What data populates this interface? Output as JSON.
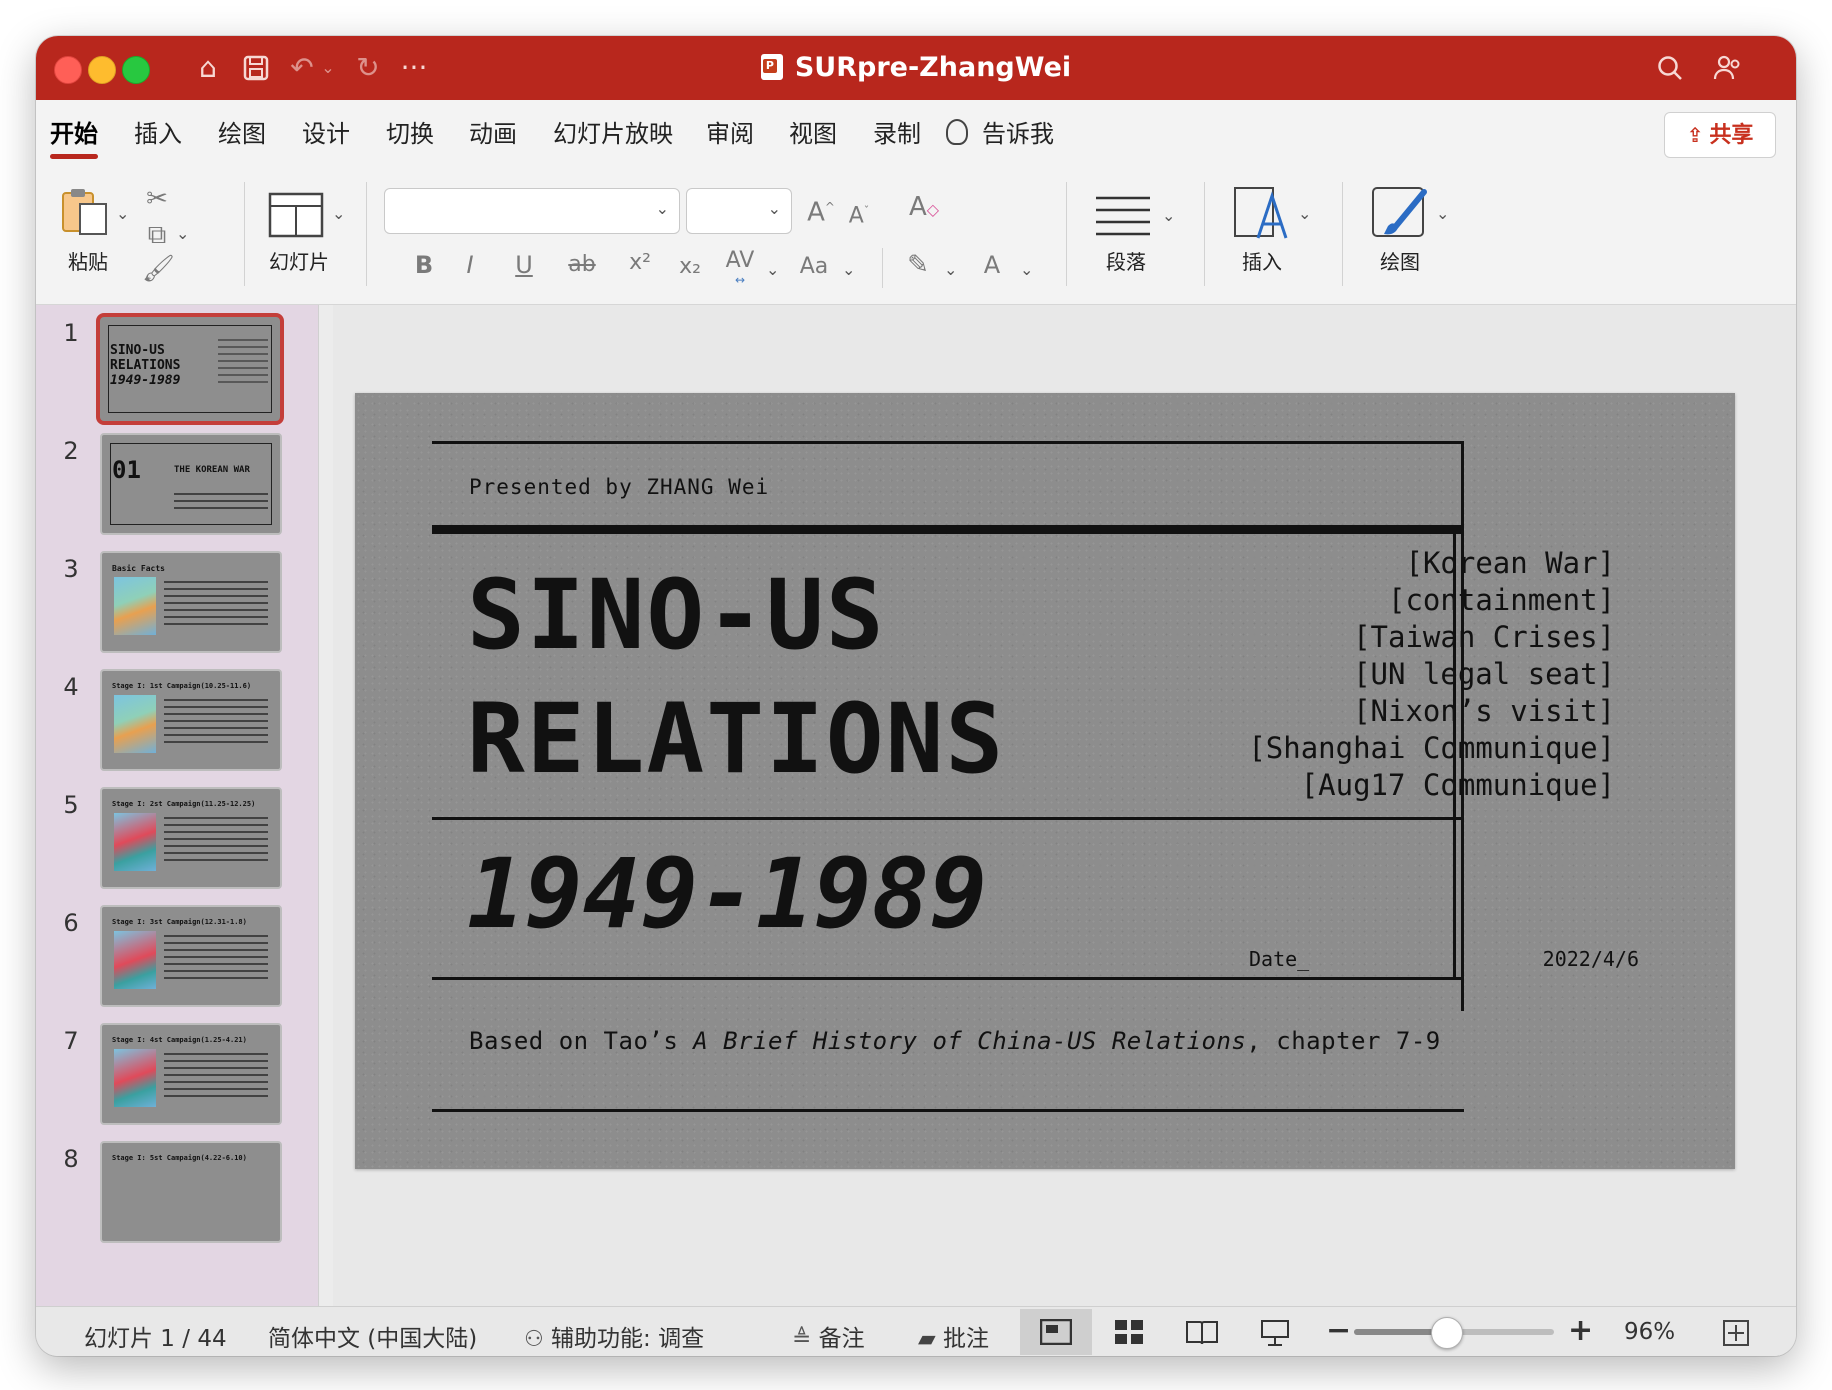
{
  "window": {
    "title": "SURpre-ZhangWei"
  },
  "tabs": [
    {
      "label": "开始",
      "active": true
    },
    {
      "label": "插入"
    },
    {
      "label": "绘图"
    },
    {
      "label": "设计"
    },
    {
      "label": "切换"
    },
    {
      "label": "动画"
    },
    {
      "label": "幻灯片放映"
    },
    {
      "label": "审阅"
    },
    {
      "label": "视图"
    },
    {
      "label": "录制"
    },
    {
      "label": "告诉我"
    }
  ],
  "share_label": "共享",
  "ribbon": {
    "paste": "粘贴",
    "slides": "幻灯片",
    "paragraph": "段落",
    "insert": "插入",
    "draw": "绘图",
    "font_name": "",
    "font_size": "",
    "bold": "B",
    "italic": "I",
    "underline": "U",
    "strike": "ab",
    "superscript": "x²",
    "subscript": "x₂",
    "spacing": "AV",
    "case": "Aa",
    "font_color": "A",
    "grow": "A",
    "shrink": "A",
    "clear": "A"
  },
  "thumbnails": [
    {
      "num": "1",
      "title_a": "SINO-US",
      "title_b": "RELATIONS",
      "title_c": "1949-1989",
      "selected": true
    },
    {
      "num": "2",
      "title_a": "01",
      "title_b": "THE KOREAN WAR"
    },
    {
      "num": "3",
      "title_a": "Basic Facts"
    },
    {
      "num": "4",
      "title_a": "Stage I: 1st Campaign(10.25-11.6)"
    },
    {
      "num": "5",
      "title_a": "Stage I: 2st Campaign(11.25-12.25)"
    },
    {
      "num": "6",
      "title_a": "Stage I: 3st Campaign(12.31-1.8)"
    },
    {
      "num": "7",
      "title_a": "Stage I: 4st Campaign(1.25-4.21)"
    },
    {
      "num": "8",
      "title_a": "Stage I: 5st Campaign(4.22-6.10)"
    }
  ],
  "slide": {
    "presented_by": "Presented by ZHANG Wei",
    "title_line1": "SINO-US",
    "title_line2": "RELATIONS",
    "years": "1949-1989",
    "tags": [
      "[Korean War]",
      "[containment]",
      "[Taiwan Crises]",
      "[UN legal seat]",
      "[Nixon’s visit]",
      "[Shanghai Communique]",
      "[Aug17 Communique]"
    ],
    "date_label": "Date_",
    "date_value": "2022/4/6",
    "footer_prefix": "Based on Tao’s ",
    "footer_book": "A Brief History of China-US Relations",
    "footer_suffix": ", chapter 7-9"
  },
  "status": {
    "slide_counter": "幻灯片 1 / 44",
    "language": "简体中文 (中国大陆)",
    "accessibility": "辅助功能: 调查",
    "notes": "备注",
    "comments": "批注",
    "zoom_minus": "−",
    "zoom_plus": "+",
    "zoom": "96%",
    "zoom_level": 0.46
  },
  "colors": {
    "titlebar": "#b8271d",
    "accent": "#c8301e"
  }
}
